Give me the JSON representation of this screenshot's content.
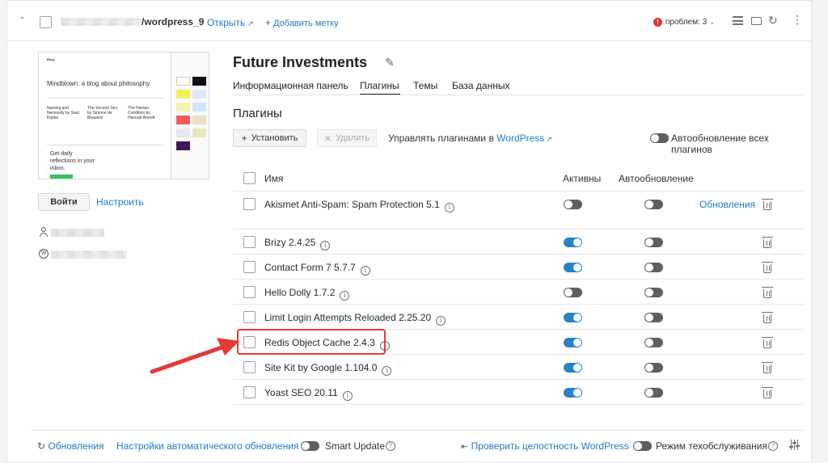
{
  "topbar": {
    "site_path": "/wordpress_9",
    "open_label": "Открыть",
    "add_tag_label": "Добавить метку",
    "problems_label": "проблем: 3"
  },
  "preview": {
    "blog_tagline": "Mindblown: a blog about philosophy.",
    "cta": "Get daily reflections in your inbox.",
    "post1": "Naming and Necessity by Saul Kripke",
    "post2": "The Second Sex by Simone de Beauvoir",
    "post3": "The Human Condition by Hannah Arendt",
    "login_button": "Войти",
    "configure_link": "Настроить"
  },
  "site": {
    "title": "Future Investments",
    "tabs": [
      "Информационная панель",
      "Плагины",
      "Темы",
      "База данных"
    ]
  },
  "plugins": {
    "heading": "Плагины",
    "install_label": "Установить",
    "delete_label": "Удалить",
    "manage_prefix": "Управлять плагинами в",
    "manage_link": "WordPress",
    "auto_update_all_label": "Автообновление всех плагинов",
    "col_name": "Имя",
    "col_active": "Активны",
    "col_autoupdate": "Автообновление",
    "update_link": "Обновления",
    "items": [
      {
        "name": "Akismet Anti-Spam: Spam Protection 5.1",
        "active": false,
        "autoupdate": false,
        "has_update": true
      },
      {
        "name": "Brizy 2.4.25",
        "active": true,
        "autoupdate": false,
        "has_update": false
      },
      {
        "name": "Contact Form 7 5.7.7",
        "active": true,
        "autoupdate": false,
        "has_update": false
      },
      {
        "name": "Hello Dolly 1.7.2",
        "active": false,
        "autoupdate": false,
        "has_update": false
      },
      {
        "name": "Limit Login Attempts Reloaded 2.25.20",
        "active": true,
        "autoupdate": false,
        "has_update": false
      },
      {
        "name": "Redis Object Cache 2.4.3",
        "active": true,
        "autoupdate": false,
        "has_update": false
      },
      {
        "name": "Site Kit by Google 1.104.0",
        "active": true,
        "autoupdate": false,
        "has_update": false
      },
      {
        "name": "Yoast SEO 20.11",
        "active": true,
        "autoupdate": false,
        "has_update": false
      }
    ]
  },
  "footer": {
    "updates_label": "Обновления",
    "auto_update_settings": "Настройки автоматического обновления",
    "smart_update": "Smart Update",
    "check_integrity": "Проверить целостность WordPress",
    "maintenance_mode": "Режим техобслуживания"
  },
  "colors": {
    "accent": "#1f7bc1",
    "toggle_on": "#2684c6",
    "highlight": "#e53935"
  }
}
